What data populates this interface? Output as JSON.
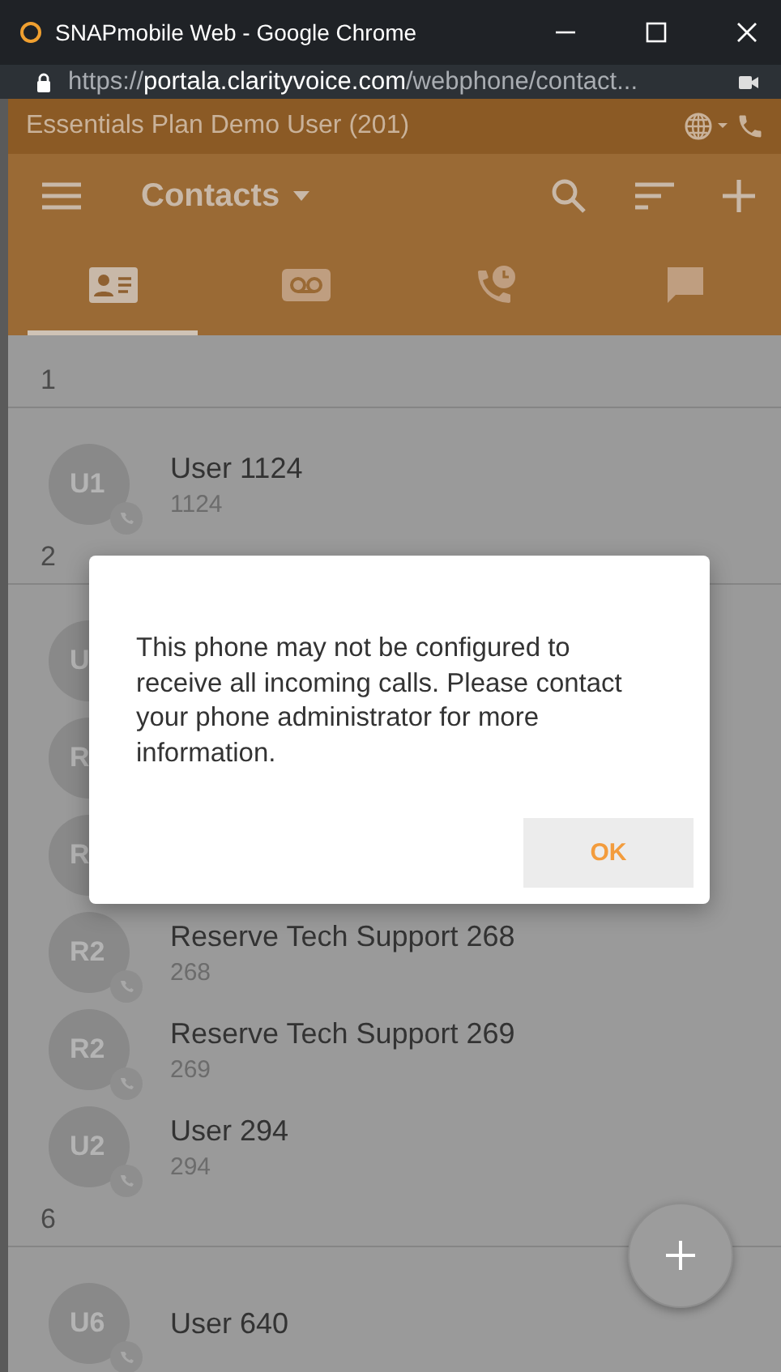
{
  "window": {
    "title": "SNAPmobile Web - Google Chrome"
  },
  "address_bar": {
    "scheme": "https://",
    "host": "portala.clarityvoice.com",
    "path": "/webphone/contact..."
  },
  "account_bar": {
    "user": "Essentials Plan Demo User (201)"
  },
  "toolbar": {
    "title": "Contacts"
  },
  "tabs": [
    {
      "kind": "contacts",
      "selected": true
    },
    {
      "kind": "voicemail",
      "selected": false
    },
    {
      "kind": "call-history",
      "selected": false
    },
    {
      "kind": "messages",
      "selected": false
    }
  ],
  "sections": [
    {
      "heading": "1",
      "contacts": [
        {
          "initials": "U1",
          "name": "User 1124",
          "number": "1124"
        }
      ]
    },
    {
      "heading": "2",
      "contacts": [
        {
          "initials": "U"
        },
        {
          "initials": "R"
        },
        {
          "initials": "R"
        },
        {
          "initials": "R2",
          "name": "Reserve Tech Support 268",
          "number": "268"
        },
        {
          "initials": "R2",
          "name": "Reserve Tech Support 269",
          "number": "269"
        },
        {
          "initials": "U2",
          "name": "User 294",
          "number": "294"
        }
      ]
    },
    {
      "heading": "6",
      "contacts": [
        {
          "initials": "U6",
          "name": "User 640"
        }
      ]
    }
  ],
  "dialog": {
    "message": "This phone may not be configured to receive all incoming calls. Please contact your phone administrator for more information.",
    "button": "OK"
  }
}
